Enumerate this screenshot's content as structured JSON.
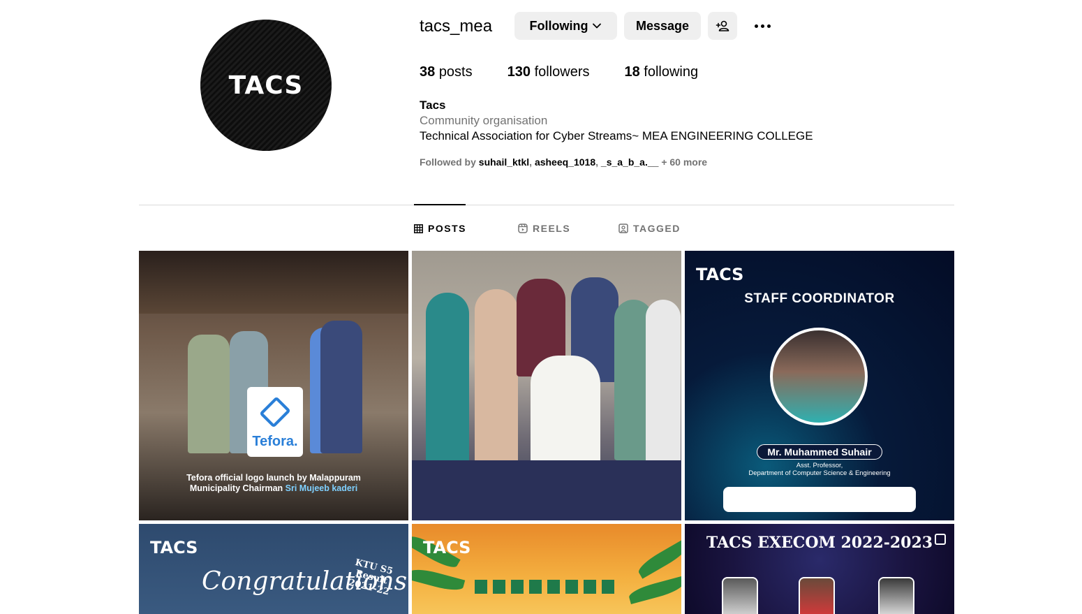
{
  "profile": {
    "avatar_logo": "TACS",
    "username": "tacs_mea",
    "following_label": "Following",
    "message_label": "Message",
    "stats": {
      "posts_count": "38",
      "posts_label": "posts",
      "followers_count": "130",
      "followers_label": "followers",
      "following_count": "18",
      "following_label": "following"
    },
    "name": "Tacs",
    "category": "Community organisation",
    "bio": "Technical Association for Cyber Streams~ MEA ENGINEERING COLLEGE",
    "followed_by": {
      "prefix": "Followed by ",
      "users": [
        "suhail_ktkl",
        "asheeq_1018",
        "_s_a_b_a.__"
      ],
      "suffix": " + 60 more"
    }
  },
  "tabs": {
    "posts": "POSTS",
    "reels": "REELS",
    "tagged": "TAGGED"
  },
  "posts": {
    "p1": {
      "card_text": "Tefora.",
      "caption_line1": "Tefora official logo launch by Malappuram",
      "caption_line2": "Municipality Chairman ",
      "caption_highlight": "Sri Mujeeb kaderi"
    },
    "p3": {
      "logo": "TACS",
      "title": "STAFF COORDINATOR",
      "name": "Mr. Muhammed Suhair",
      "role_line1": "Asst. Professor,",
      "role_line2": "Department of Computer Science & Engineering"
    },
    "p4": {
      "logo": "TACS",
      "congrats": "Congratulations",
      "ktu_line1": "KTU S5 Result",
      "ktu_line2": "2021-22"
    },
    "p5": {
      "logo": "TACS"
    },
    "p6": {
      "title": "TACS EXECOM 2022-2023"
    }
  },
  "colors": {
    "button_bg": "#efefef",
    "muted_text": "#737373",
    "divider": "#dbdbdb"
  },
  "icons": {
    "following_chevron": "chevron-down-icon",
    "add_user": "add-user-icon",
    "more": "more-icon",
    "posts_tab": "grid-icon",
    "reels_tab": "reels-icon",
    "tagged_tab": "tagged-icon",
    "carousel": "carousel-icon"
  }
}
